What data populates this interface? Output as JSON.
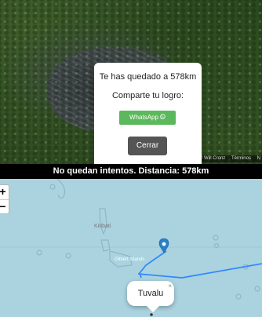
{
  "photo": {
    "attribution": [
      "© Will Cronz",
      "Términos",
      "N"
    ]
  },
  "result_modal": {
    "message": "Te has quedado a 578km",
    "share_label": "Comparte tu logro:",
    "whatsapp_label": "WhatsApp",
    "whatsapp_icon": "whatsapp-icon",
    "close_label": "Cerrar"
  },
  "status": {
    "text": "No quedan intentos. Distancia: 578km"
  },
  "map": {
    "zoom_in": "+",
    "zoom_out": "−",
    "labels": {
      "kiribati": "Kiribati",
      "gilbert": "Gilbert Islands"
    },
    "popup": {
      "text": "Tuvalu",
      "close": "×"
    },
    "colors": {
      "ocean": "#aad3df",
      "route_line": "#3388ff",
      "marker": "#2a81cb",
      "whatsapp": "#5cb85c"
    }
  }
}
